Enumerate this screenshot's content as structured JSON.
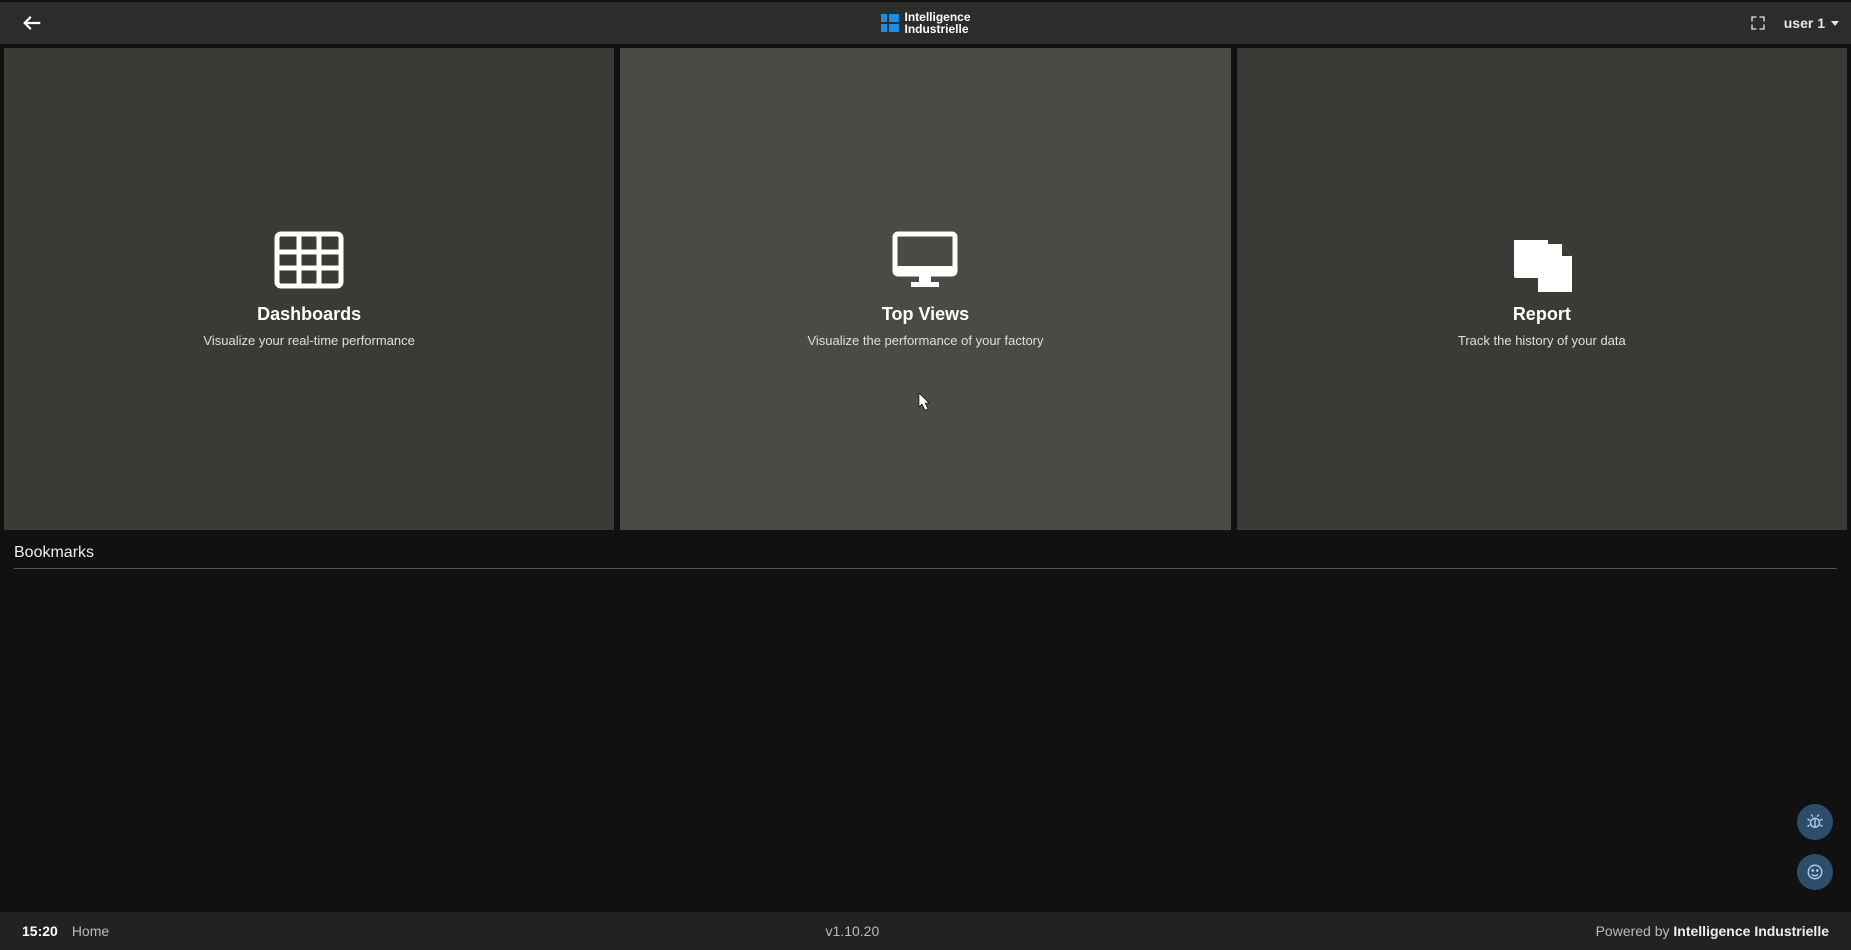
{
  "brand": {
    "line1": "Intelligence",
    "line2": "Industrielle"
  },
  "user": {
    "label": "user 1"
  },
  "tiles": [
    {
      "title": "Dashboards",
      "desc": "Visualize your real-time performance"
    },
    {
      "title": "Top Views",
      "desc": "Visualize the performance of your factory"
    },
    {
      "title": "Report",
      "desc": "Track the history of your data"
    }
  ],
  "bookmarks": {
    "heading": "Bookmarks"
  },
  "footer": {
    "clock": "15:20",
    "breadcrumb": "Home",
    "version": "v1.10.20",
    "powered_prefix": "Powered by ",
    "powered_brand": "Intelligence Industrielle"
  }
}
